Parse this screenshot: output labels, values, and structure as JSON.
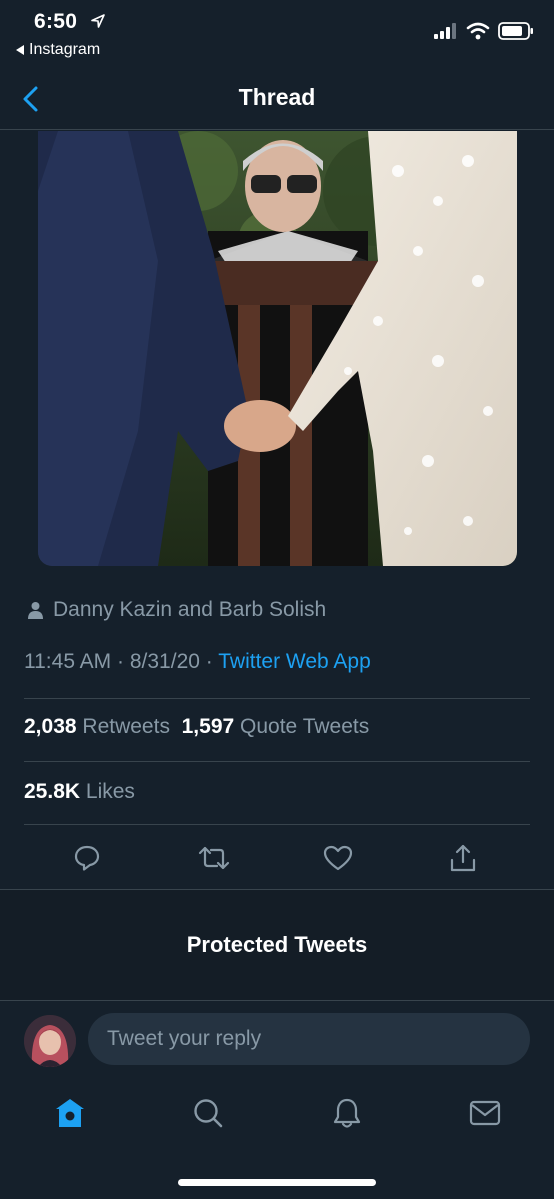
{
  "status_bar": {
    "time": "6:50",
    "back_app": "Instagram"
  },
  "header": {
    "title": "Thread"
  },
  "tweet": {
    "image_icon": "wedding-photo",
    "tagged_users": "Danny Kazin and Barb Solish",
    "time": "11:45 AM",
    "date": "8/31/20",
    "separator": "·",
    "source": "Twitter Web App",
    "retweets_count": "2,038",
    "retweets_label": "Retweets",
    "quote_tweets_count": "1,597",
    "quote_tweets_label": "Quote Tweets",
    "likes_count": "25.8K",
    "likes_label": "Likes"
  },
  "actions": [
    "reply-icon",
    "retweet-icon",
    "like-icon",
    "share-icon"
  ],
  "protected": {
    "label": "Protected Tweets"
  },
  "reply": {
    "placeholder": "Tweet your reply"
  },
  "tab_bar": [
    "home-icon",
    "search-icon",
    "notifications-icon",
    "messages-icon"
  ],
  "colors": {
    "background": "#15202b",
    "accent": "#1da1f2",
    "muted_text": "#8899a6",
    "divider": "#38444d"
  }
}
